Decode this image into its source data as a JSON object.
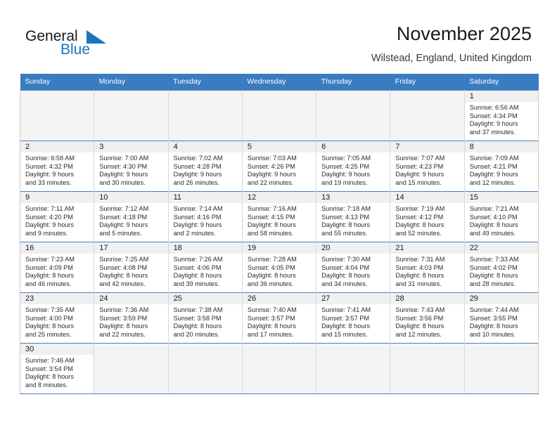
{
  "brand": {
    "name_top": "General",
    "name_bottom": "Blue",
    "flag_icon": "blue-triangle-flag-icon",
    "color_dark": "#1a1a1a",
    "color_blue": "#1b75bb"
  },
  "header": {
    "title": "November 2025",
    "subtitle": "Wilstead, England, United Kingdom"
  },
  "theme": {
    "header_row_bg": "#3a7cc0",
    "header_row_text": "#ffffff",
    "daynum_bg": "#f0f0f0",
    "empty_cell_bg": "#f4f4f4",
    "grid_border": "#4a80b8"
  },
  "weekdays": [
    "Sunday",
    "Monday",
    "Tuesday",
    "Wednesday",
    "Thursday",
    "Friday",
    "Saturday"
  ],
  "weeks": [
    [
      {
        "day": "",
        "lines": []
      },
      {
        "day": "",
        "lines": []
      },
      {
        "day": "",
        "lines": []
      },
      {
        "day": "",
        "lines": []
      },
      {
        "day": "",
        "lines": []
      },
      {
        "day": "",
        "lines": []
      },
      {
        "day": "1",
        "lines": [
          "Sunrise: 6:56 AM",
          "Sunset: 4:34 PM",
          "Daylight: 9 hours",
          "and 37 minutes."
        ]
      }
    ],
    [
      {
        "day": "2",
        "lines": [
          "Sunrise: 6:58 AM",
          "Sunset: 4:32 PM",
          "Daylight: 9 hours",
          "and 33 minutes."
        ]
      },
      {
        "day": "3",
        "lines": [
          "Sunrise: 7:00 AM",
          "Sunset: 4:30 PM",
          "Daylight: 9 hours",
          "and 30 minutes."
        ]
      },
      {
        "day": "4",
        "lines": [
          "Sunrise: 7:02 AM",
          "Sunset: 4:28 PM",
          "Daylight: 9 hours",
          "and 26 minutes."
        ]
      },
      {
        "day": "5",
        "lines": [
          "Sunrise: 7:03 AM",
          "Sunset: 4:26 PM",
          "Daylight: 9 hours",
          "and 22 minutes."
        ]
      },
      {
        "day": "6",
        "lines": [
          "Sunrise: 7:05 AM",
          "Sunset: 4:25 PM",
          "Daylight: 9 hours",
          "and 19 minutes."
        ]
      },
      {
        "day": "7",
        "lines": [
          "Sunrise: 7:07 AM",
          "Sunset: 4:23 PM",
          "Daylight: 9 hours",
          "and 15 minutes."
        ]
      },
      {
        "day": "8",
        "lines": [
          "Sunrise: 7:09 AM",
          "Sunset: 4:21 PM",
          "Daylight: 9 hours",
          "and 12 minutes."
        ]
      }
    ],
    [
      {
        "day": "9",
        "lines": [
          "Sunrise: 7:11 AM",
          "Sunset: 4:20 PM",
          "Daylight: 9 hours",
          "and 9 minutes."
        ]
      },
      {
        "day": "10",
        "lines": [
          "Sunrise: 7:12 AM",
          "Sunset: 4:18 PM",
          "Daylight: 9 hours",
          "and 5 minutes."
        ]
      },
      {
        "day": "11",
        "lines": [
          "Sunrise: 7:14 AM",
          "Sunset: 4:16 PM",
          "Daylight: 9 hours",
          "and 2 minutes."
        ]
      },
      {
        "day": "12",
        "lines": [
          "Sunrise: 7:16 AM",
          "Sunset: 4:15 PM",
          "Daylight: 8 hours",
          "and 58 minutes."
        ]
      },
      {
        "day": "13",
        "lines": [
          "Sunrise: 7:18 AM",
          "Sunset: 4:13 PM",
          "Daylight: 8 hours",
          "and 55 minutes."
        ]
      },
      {
        "day": "14",
        "lines": [
          "Sunrise: 7:19 AM",
          "Sunset: 4:12 PM",
          "Daylight: 8 hours",
          "and 52 minutes."
        ]
      },
      {
        "day": "15",
        "lines": [
          "Sunrise: 7:21 AM",
          "Sunset: 4:10 PM",
          "Daylight: 8 hours",
          "and 49 minutes."
        ]
      }
    ],
    [
      {
        "day": "16",
        "lines": [
          "Sunrise: 7:23 AM",
          "Sunset: 4:09 PM",
          "Daylight: 8 hours",
          "and 46 minutes."
        ]
      },
      {
        "day": "17",
        "lines": [
          "Sunrise: 7:25 AM",
          "Sunset: 4:08 PM",
          "Daylight: 8 hours",
          "and 42 minutes."
        ]
      },
      {
        "day": "18",
        "lines": [
          "Sunrise: 7:26 AM",
          "Sunset: 4:06 PM",
          "Daylight: 8 hours",
          "and 39 minutes."
        ]
      },
      {
        "day": "19",
        "lines": [
          "Sunrise: 7:28 AM",
          "Sunset: 4:05 PM",
          "Daylight: 8 hours",
          "and 36 minutes."
        ]
      },
      {
        "day": "20",
        "lines": [
          "Sunrise: 7:30 AM",
          "Sunset: 4:04 PM",
          "Daylight: 8 hours",
          "and 34 minutes."
        ]
      },
      {
        "day": "21",
        "lines": [
          "Sunrise: 7:31 AM",
          "Sunset: 4:03 PM",
          "Daylight: 8 hours",
          "and 31 minutes."
        ]
      },
      {
        "day": "22",
        "lines": [
          "Sunrise: 7:33 AM",
          "Sunset: 4:02 PM",
          "Daylight: 8 hours",
          "and 28 minutes."
        ]
      }
    ],
    [
      {
        "day": "23",
        "lines": [
          "Sunrise: 7:35 AM",
          "Sunset: 4:00 PM",
          "Daylight: 8 hours",
          "and 25 minutes."
        ]
      },
      {
        "day": "24",
        "lines": [
          "Sunrise: 7:36 AM",
          "Sunset: 3:59 PM",
          "Daylight: 8 hours",
          "and 22 minutes."
        ]
      },
      {
        "day": "25",
        "lines": [
          "Sunrise: 7:38 AM",
          "Sunset: 3:58 PM",
          "Daylight: 8 hours",
          "and 20 minutes."
        ]
      },
      {
        "day": "26",
        "lines": [
          "Sunrise: 7:40 AM",
          "Sunset: 3:57 PM",
          "Daylight: 8 hours",
          "and 17 minutes."
        ]
      },
      {
        "day": "27",
        "lines": [
          "Sunrise: 7:41 AM",
          "Sunset: 3:57 PM",
          "Daylight: 8 hours",
          "and 15 minutes."
        ]
      },
      {
        "day": "28",
        "lines": [
          "Sunrise: 7:43 AM",
          "Sunset: 3:56 PM",
          "Daylight: 8 hours",
          "and 12 minutes."
        ]
      },
      {
        "day": "29",
        "lines": [
          "Sunrise: 7:44 AM",
          "Sunset: 3:55 PM",
          "Daylight: 8 hours",
          "and 10 minutes."
        ]
      }
    ],
    [
      {
        "day": "30",
        "lines": [
          "Sunrise: 7:46 AM",
          "Sunset: 3:54 PM",
          "Daylight: 8 hours",
          "and 8 minutes."
        ]
      },
      {
        "day": "",
        "lines": []
      },
      {
        "day": "",
        "lines": []
      },
      {
        "day": "",
        "lines": []
      },
      {
        "day": "",
        "lines": []
      },
      {
        "day": "",
        "lines": []
      },
      {
        "day": "",
        "lines": []
      }
    ]
  ]
}
